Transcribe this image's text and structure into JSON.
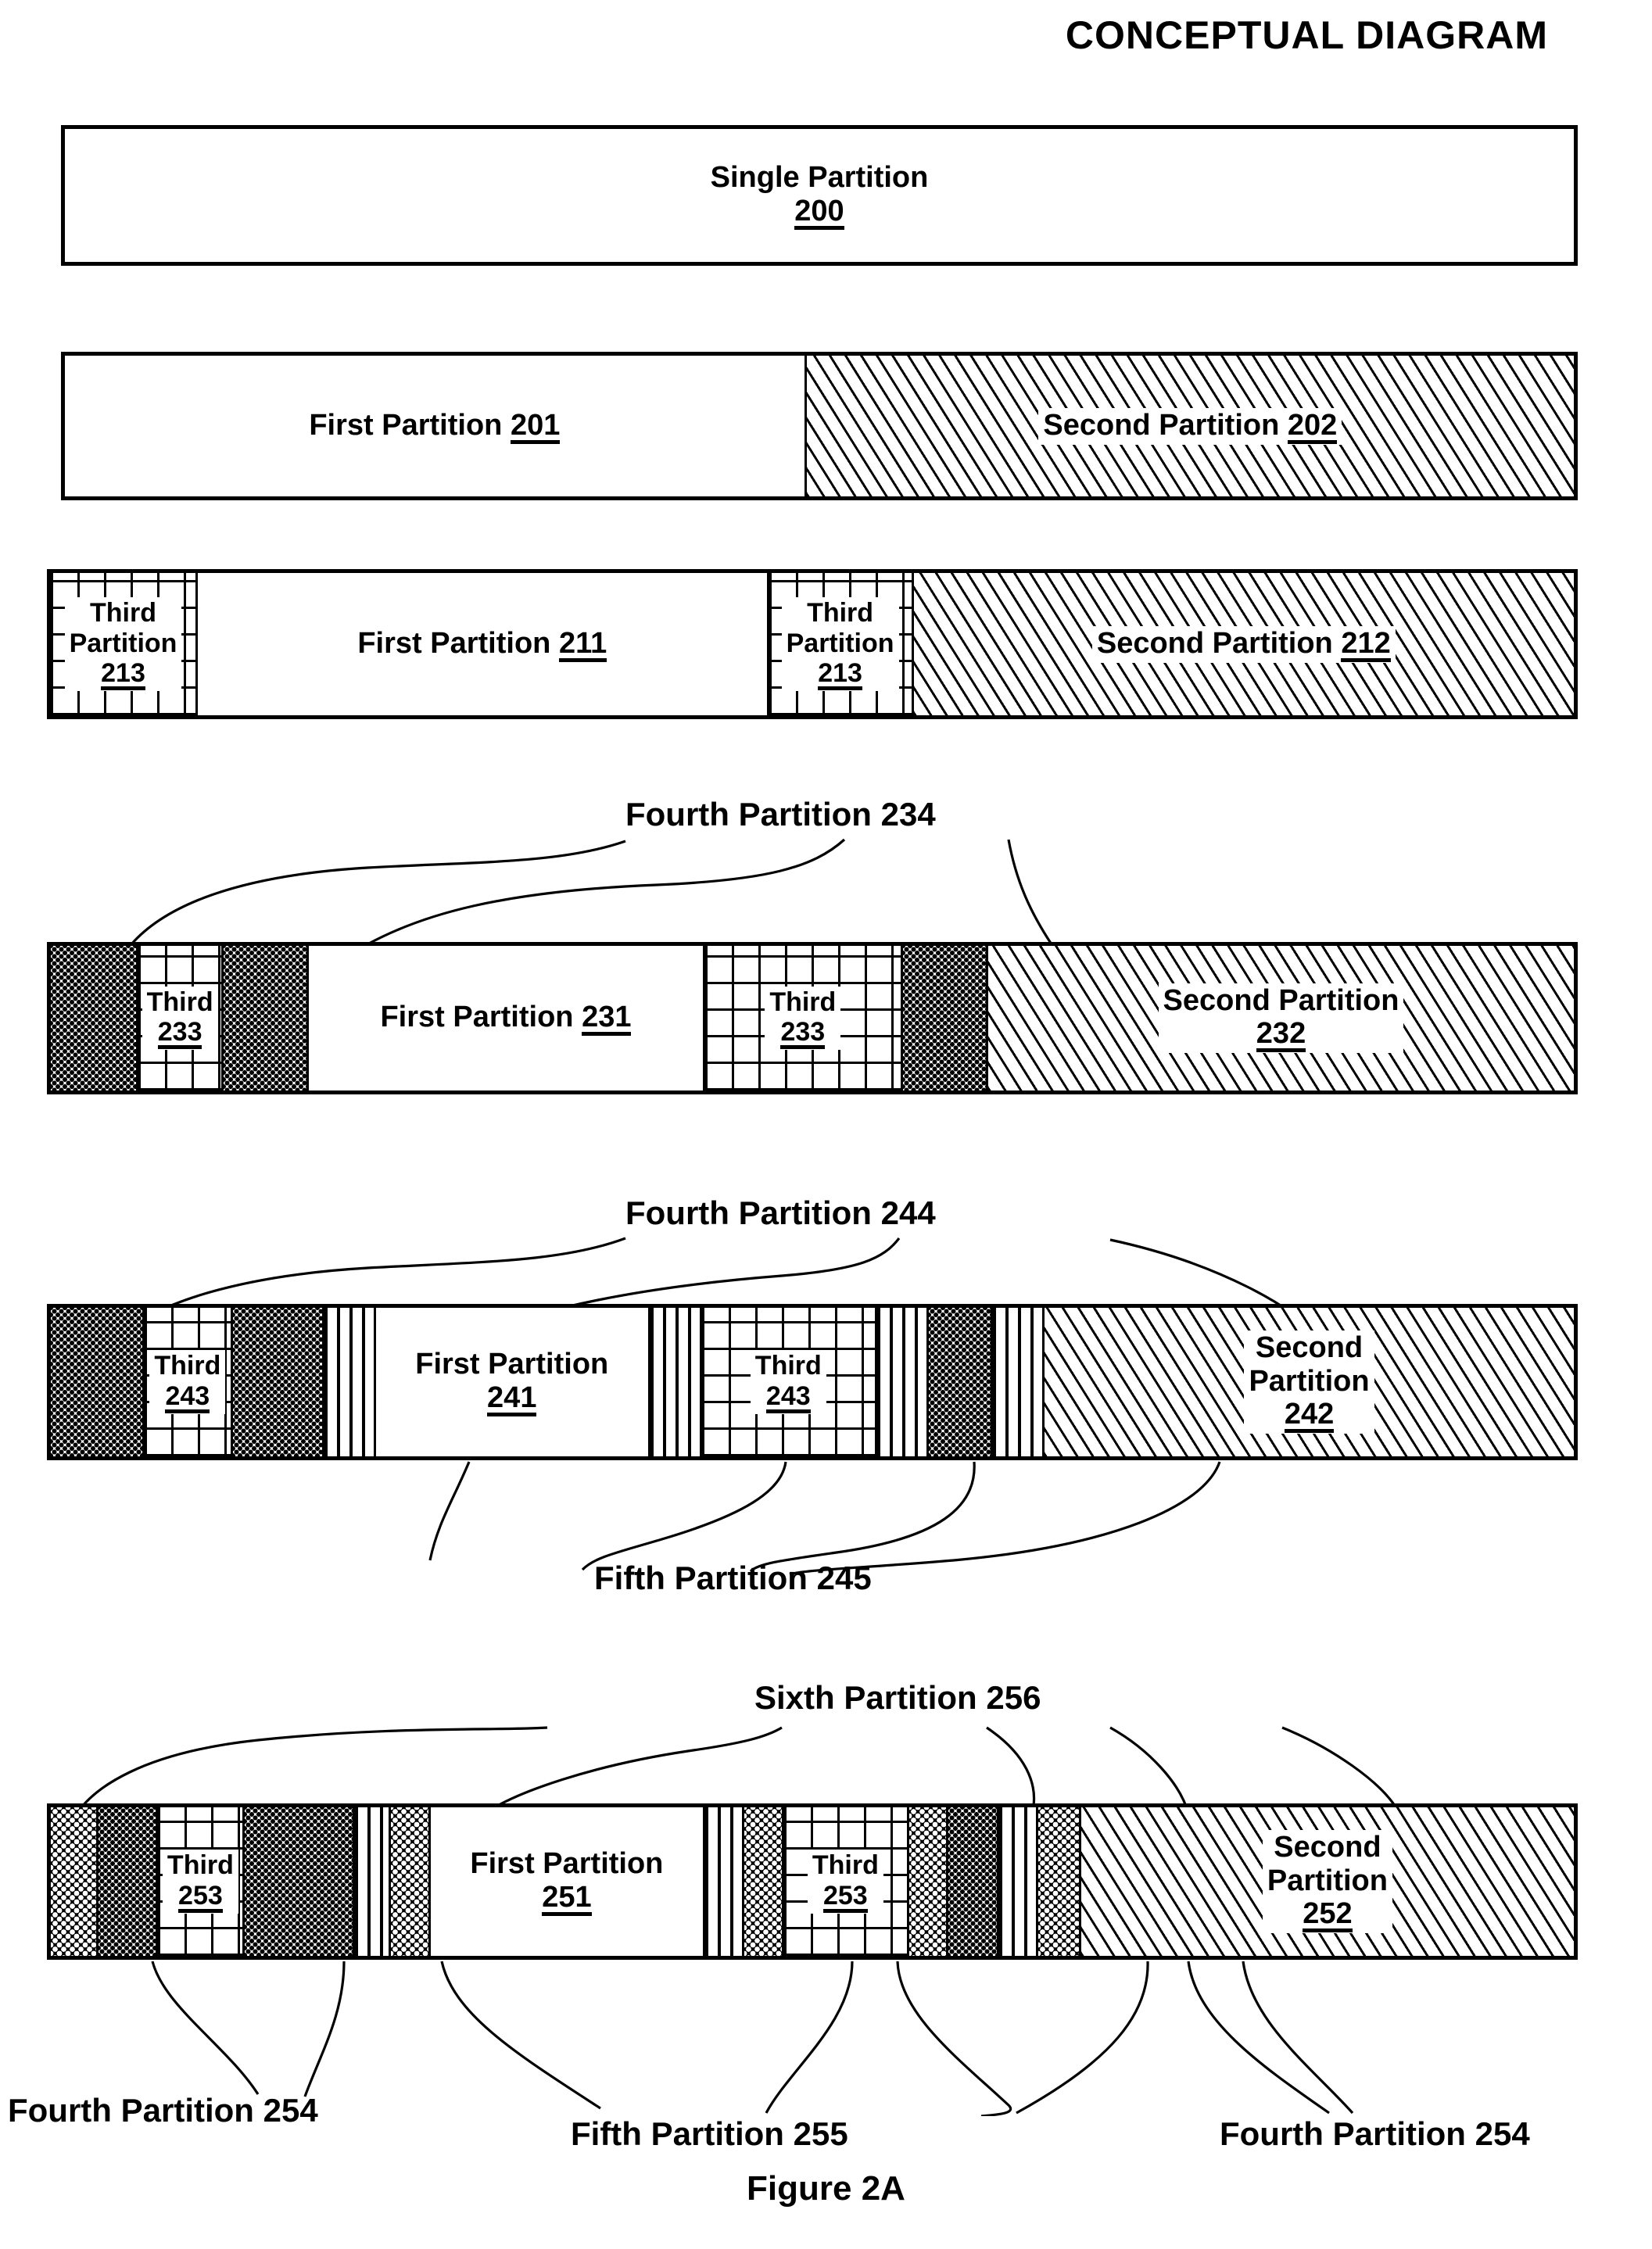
{
  "title": "CONCEPTUAL DIAGRAM",
  "figure_caption": "Figure 2A",
  "colors": {
    "ink": "#000000",
    "paper": "#ffffff"
  },
  "patterns": {
    "first_partition": "white",
    "second_partition": "diagonal-hatch",
    "third_partition": "crosshatch-grid",
    "fourth_partition": "fine-stipple-dots",
    "fifth_partition": "vertical-lines",
    "sixth_partition": "dark-stipple"
  },
  "bars": [
    {
      "id": "bar-1",
      "segments": [
        {
          "name": "single-partition",
          "label_line1": "Single Partition",
          "label_line2": "200",
          "pattern": "white"
        }
      ]
    },
    {
      "id": "bar-2",
      "segments": [
        {
          "name": "first-partition",
          "label_line1": "First Partition",
          "number": "201",
          "pattern": "white"
        },
        {
          "name": "second-partition",
          "label_line1": "Second Partition",
          "number": "202",
          "pattern": "diagonal-hatch"
        }
      ]
    },
    {
      "id": "bar-3",
      "segments": [
        {
          "name": "third-partition",
          "label_line1": "Third",
          "label_line2": "Partition",
          "label_line3": "213",
          "pattern": "crosshatch-grid"
        },
        {
          "name": "first-partition",
          "label_line1": "First Partition",
          "number": "211",
          "pattern": "white"
        },
        {
          "name": "third-partition",
          "label_line1": "Third",
          "label_line2": "Partition",
          "label_line3": "213",
          "pattern": "crosshatch-grid"
        },
        {
          "name": "second-partition",
          "label_line1": "Second Partition",
          "number": "212",
          "pattern": "diagonal-hatch"
        }
      ]
    },
    {
      "id": "bar-4",
      "callout_top": "Fourth Partition 234",
      "segments": [
        {
          "name": "fourth-partition",
          "pattern": "fine-stipple-dots"
        },
        {
          "name": "third-partition",
          "label_line1": "Third",
          "label_line2": "233",
          "pattern": "crosshatch-grid"
        },
        {
          "name": "fourth-partition",
          "pattern": "fine-stipple-dots"
        },
        {
          "name": "first-partition",
          "label_line1": "First Partition",
          "number": "231",
          "pattern": "white"
        },
        {
          "name": "third-partition",
          "label_line1": "Third",
          "label_line2": "233",
          "pattern": "crosshatch-grid"
        },
        {
          "name": "fourth-partition",
          "pattern": "fine-stipple-dots"
        },
        {
          "name": "second-partition",
          "label_line1": "Second Partition",
          "label_line2": "232",
          "pattern": "diagonal-hatch"
        }
      ]
    },
    {
      "id": "bar-5",
      "callout_top": "Fourth Partition 244",
      "callout_bottom": "Fifth Partition 245",
      "segments": [
        {
          "name": "fourth-partition",
          "pattern": "fine-stipple-dots"
        },
        {
          "name": "third-partition",
          "label_line1": "Third",
          "label_line2": "243",
          "pattern": "crosshatch-grid"
        },
        {
          "name": "fourth-partition",
          "pattern": "fine-stipple-dots"
        },
        {
          "name": "fifth-partition",
          "pattern": "vertical-lines"
        },
        {
          "name": "first-partition",
          "label_line1": "First Partition",
          "label_line2": "241",
          "pattern": "white"
        },
        {
          "name": "fifth-partition",
          "pattern": "vertical-lines"
        },
        {
          "name": "third-partition",
          "label_line1": "Third",
          "label_line2": "243",
          "pattern": "crosshatch-grid"
        },
        {
          "name": "fifth-partition",
          "pattern": "vertical-lines"
        },
        {
          "name": "fourth-partition",
          "pattern": "fine-stipple-dots"
        },
        {
          "name": "fifth-partition",
          "pattern": "vertical-lines"
        },
        {
          "name": "second-partition",
          "label_line1": "Second",
          "label_line2": "Partition",
          "label_line3": "242",
          "pattern": "diagonal-hatch"
        }
      ]
    },
    {
      "id": "bar-6",
      "callout_top": "Sixth Partition 256",
      "callout_bottom_left": "Fourth Partition 254",
      "callout_bottom_center": "Fifth Partition 255",
      "callout_bottom_right": "Fourth Partition 254",
      "segments": [
        {
          "name": "sixth-partition",
          "pattern": "dark-stipple"
        },
        {
          "name": "fourth-partition",
          "pattern": "fine-stipple-dots"
        },
        {
          "name": "third-partition",
          "label_line1": "Third",
          "label_line2": "253",
          "pattern": "crosshatch-grid"
        },
        {
          "name": "fourth-partition",
          "pattern": "fine-stipple-dots"
        },
        {
          "name": "fifth-partition",
          "pattern": "vertical-lines"
        },
        {
          "name": "sixth-partition",
          "pattern": "dark-stipple"
        },
        {
          "name": "first-partition",
          "label_line1": "First Partition",
          "label_line2": "251",
          "pattern": "white"
        },
        {
          "name": "fifth-partition",
          "pattern": "vertical-lines"
        },
        {
          "name": "sixth-partition",
          "pattern": "dark-stipple"
        },
        {
          "name": "third-partition",
          "label_line1": "Third",
          "label_line2": "253",
          "pattern": "crosshatch-grid"
        },
        {
          "name": "sixth-partition",
          "pattern": "dark-stipple"
        },
        {
          "name": "fourth-partition",
          "pattern": "fine-stipple-dots"
        },
        {
          "name": "fifth-partition",
          "pattern": "vertical-lines"
        },
        {
          "name": "sixth-partition",
          "pattern": "dark-stipple"
        },
        {
          "name": "second-partition",
          "label_line1": "Second",
          "label_line2": "Partition",
          "label_line3": "252",
          "pattern": "diagonal-hatch"
        }
      ]
    }
  ],
  "labels": {
    "single_partition": "Single Partition",
    "n200": "200",
    "first_partition": "First Partition",
    "second_partition": "Second Partition",
    "third": "Third",
    "partition": "Partition",
    "second": "Second",
    "n201": "201",
    "n202": "202",
    "n211": "211",
    "n212": "212",
    "n213": "213",
    "n231": "231",
    "n232": "232",
    "n233": "233",
    "n241": "241",
    "n242": "242",
    "n243": "243",
    "n251": "251",
    "n252": "252",
    "n253": "253",
    "fourth_partition_234": "Fourth Partition 234",
    "fourth_partition_244": "Fourth Partition 244",
    "fifth_partition_245": "Fifth Partition 245",
    "sixth_partition_256": "Sixth Partition 256",
    "fourth_partition_254_left": "Fourth Partition 254",
    "fifth_partition_255": "Fifth Partition 255",
    "fourth_partition_254_right": "Fourth Partition 254"
  }
}
